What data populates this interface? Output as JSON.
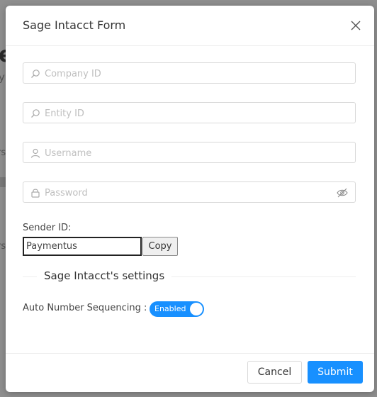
{
  "background": {
    "fragment_e": "e",
    "fragment_y": "y",
    "fragment_rs1": "rs",
    "fragment_rs2": "rs"
  },
  "modal": {
    "title": "Sage Intacct Form",
    "fields": {
      "company_id": {
        "placeholder": "Company ID",
        "icon": "search-icon"
      },
      "entity_id": {
        "placeholder": "Entity ID",
        "icon": "search-icon"
      },
      "username": {
        "placeholder": "Username",
        "icon": "user-icon"
      },
      "password": {
        "placeholder": "Password",
        "icon": "lock-icon"
      }
    },
    "sender": {
      "label": "Sender ID:",
      "value": "Paymentus",
      "copy_label": "Copy"
    },
    "settings": {
      "section_title": "Sage Intacct's settings",
      "auto_number_label": "Auto Number Sequencing :",
      "toggle_text": "Enabled",
      "toggle_on": true
    },
    "footer": {
      "cancel_label": "Cancel",
      "submit_label": "Submit"
    }
  },
  "colors": {
    "primary": "#1890ff",
    "overlay": "#8f8f8f",
    "border": "#d9d9d9",
    "placeholder": "#bfbfbf"
  }
}
